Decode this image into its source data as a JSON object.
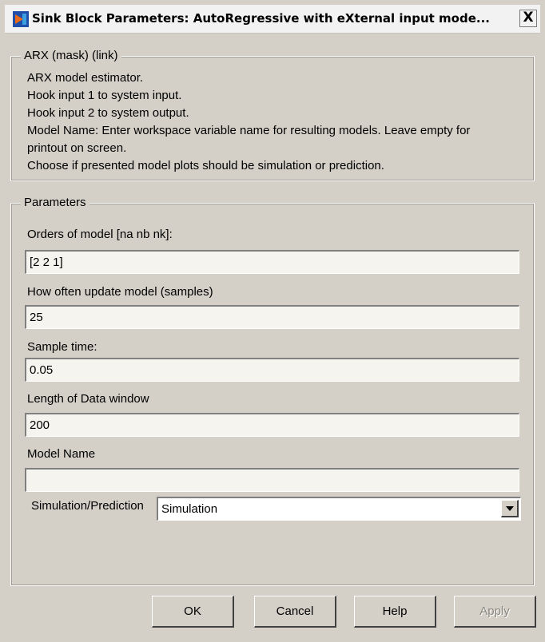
{
  "window": {
    "title": "Sink Block Parameters: AutoRegressive  with eXternal input mode...",
    "close_label": "X"
  },
  "description_group": {
    "legend": "ARX (mask) (link)",
    "lines": [
      "ARX model estimator.",
      "Hook input 1 to system input.",
      "Hook input 2 to system output.",
      "Model Name: Enter workspace variable name for resulting models. Leave empty for",
      "printout on screen.",
      "Choose if presented model plots should be simulation or prediction."
    ]
  },
  "parameters_group": {
    "legend": "Parameters",
    "fields": [
      {
        "label": "Orders of model [na nb nk]:",
        "value": "[2 2 1]"
      },
      {
        "label": "How often update model (samples)",
        "value": "25"
      },
      {
        "label": "Sample time:",
        "value": "0.05"
      },
      {
        "label": "Length of Data window",
        "value": "200"
      },
      {
        "label": "Model Name",
        "value": ""
      }
    ],
    "dropdown": {
      "label": "Simulation/Prediction",
      "value": "Simulation"
    }
  },
  "buttons": {
    "ok": "OK",
    "cancel": "Cancel",
    "help": "Help",
    "apply": "Apply"
  },
  "colors": {
    "dialog_bg": "#d4d0c8",
    "input_bg": "#f6f4ef"
  }
}
